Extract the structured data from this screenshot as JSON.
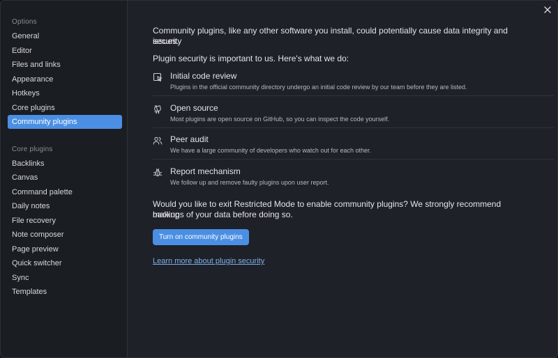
{
  "sidebar": {
    "options_heading": "Options",
    "options": [
      {
        "label": "General"
      },
      {
        "label": "Editor"
      },
      {
        "label": "Files and links"
      },
      {
        "label": "Appearance"
      },
      {
        "label": "Hotkeys"
      },
      {
        "label": "Core plugins"
      },
      {
        "label": "Community plugins",
        "active": true
      }
    ],
    "core_heading": "Core plugins",
    "core_plugins": [
      {
        "label": "Backlinks"
      },
      {
        "label": "Canvas"
      },
      {
        "label": "Command palette"
      },
      {
        "label": "Daily notes"
      },
      {
        "label": "File recovery"
      },
      {
        "label": "Note composer"
      },
      {
        "label": "Page preview"
      },
      {
        "label": "Quick switcher"
      },
      {
        "label": "Sync"
      },
      {
        "label": "Templates"
      }
    ]
  },
  "main": {
    "intro_line1": "Community plugins, like any other software you install, could potentially cause data integrity and security",
    "intro_line2": "issues.",
    "security_intro": "Plugin security is important to us. Here's what we do:",
    "features": [
      {
        "icon": "code-review-icon",
        "title": "Initial code review",
        "description": "Plugins in the official community directory undergo an initial code review by our team before they are listed."
      },
      {
        "icon": "github-icon",
        "title": "Open source",
        "description": "Most plugins are open source on GitHub, so you can inspect the code yourself."
      },
      {
        "icon": "users-icon",
        "title": "Peer audit",
        "description": "We have a large community of developers who watch out for each other."
      },
      {
        "icon": "bug-icon",
        "title": "Report mechanism",
        "description": "We follow up and remove faulty plugins upon user report."
      }
    ],
    "restricted_line1": "Would you like to exit Restricted Mode to enable community plugins? We strongly recommend making",
    "restricted_line2": "backups of your data before doing so.",
    "enable_button": "Turn on community plugins",
    "learn_more": "Learn more about plugin security"
  },
  "colors": {
    "accent": "#4a8fe3",
    "link": "#7fb0ec",
    "background": "#1e2127",
    "sidebar_background": "#1a1d22"
  }
}
